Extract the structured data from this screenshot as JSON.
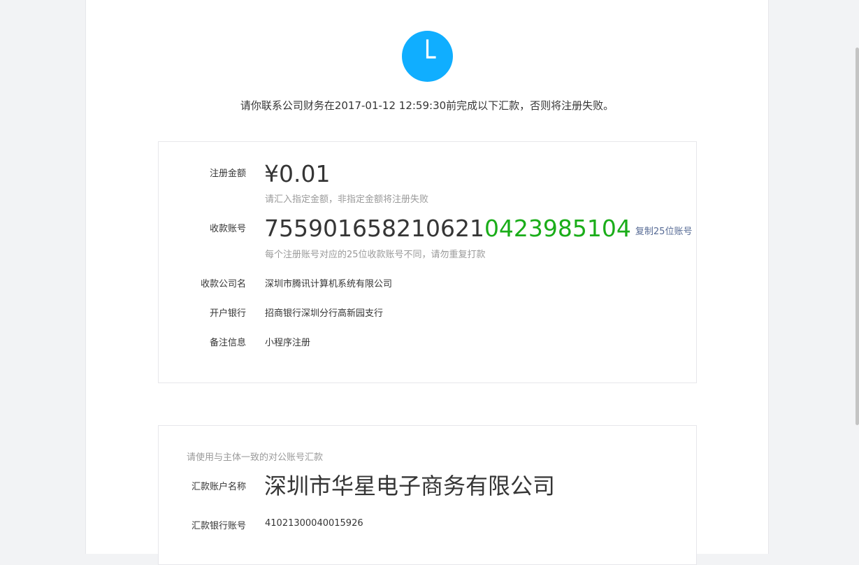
{
  "status_icon": "clock-icon",
  "colors": {
    "clock_bg": "#10aeff",
    "account_highlight": "#1aad19",
    "link": "#576b95",
    "tip_text": "#9a9a9a"
  },
  "notice": "请你联系公司财务在2017-01-12 12:59:30前完成以下汇款，否则将注册失败。",
  "payment_info": {
    "amount_label": "注册金额",
    "amount": "¥0.01",
    "amount_tip": "请汇入指定金额，非指定金额将注册失败",
    "account_label": "收款账号",
    "account_prefix": "755901658210621",
    "account_suffix": "0423985104",
    "copy_label": "复制25位账号",
    "account_tip": "每个注册账号对应的25位收款账号不同，请勿重复打款",
    "company_label": "收款公司名",
    "company": "深圳市腾讯计算机系统有限公司",
    "bank_label": "开户银行",
    "bank": "招商银行深圳分行高新园支行",
    "remark_label": "备注信息",
    "remark": "小程序注册"
  },
  "remitter_info": {
    "hint": "请使用与主体一致的对公账号汇款",
    "name_label": "汇款账户名称",
    "name": "深圳市华星电子商务有限公司",
    "account_label": "汇款银行账号",
    "account": "41021300040015926"
  }
}
